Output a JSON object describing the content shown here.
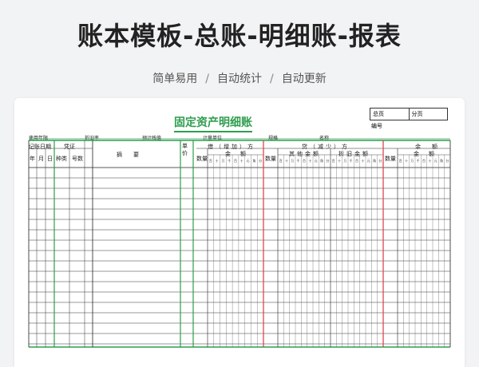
{
  "header": {
    "title": "账本模板-总账-明细账-报表",
    "subtitle_items": [
      "简单易用",
      "自动统计",
      "自动更新"
    ],
    "separator": "/"
  },
  "ledger": {
    "title": "固定资产明细账",
    "page_total_label": "总页",
    "page_part_label": "分页",
    "code_label": "编号",
    "meta": {
      "use_years": "使用年限",
      "depreciation_rate": "折旧率",
      "residual_value": "预计残值",
      "unit": "计量单位",
      "spec": "规格",
      "name": "名称"
    },
    "columns": {
      "date_group": "记账日期",
      "voucher_group": "凭证",
      "year": "年",
      "month": "月",
      "day": "日",
      "kind": "种类",
      "number": "号数",
      "summary": "摘要",
      "unit_price": "单价",
      "debit_group": "借（增加）方",
      "credit_group": "贷（减少）方",
      "balance_group": "余额",
      "quantity": "数量",
      "amount": "金额",
      "other_amount": "其他金额",
      "depreciation_amount": "折旧金额",
      "digits": [
        "百",
        "十",
        "万",
        "千",
        "百",
        "十",
        "元",
        "角",
        "分"
      ]
    },
    "colors": {
      "green": "#2e9d4e",
      "red": "#e0464f",
      "black": "#222222"
    }
  }
}
